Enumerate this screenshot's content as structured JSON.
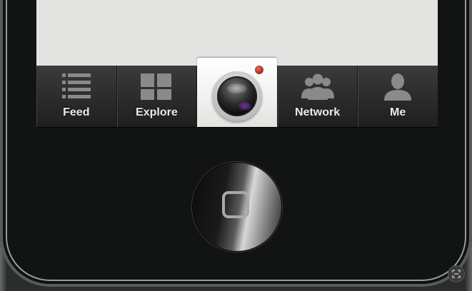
{
  "tabbar": {
    "items": [
      {
        "label": "Feed",
        "icon": "list-icon"
      },
      {
        "label": "Explore",
        "icon": "grid-icon"
      },
      {
        "label": "",
        "icon": "camera-lens-icon"
      },
      {
        "label": "Network",
        "icon": "people-icon"
      },
      {
        "label": "Me",
        "icon": "person-icon"
      }
    ]
  },
  "colors": {
    "screen_background": "#e3e3e2",
    "tabbar": "#2e2f2f",
    "icon_gray": "#8c8c8c",
    "record_dot": "#d02010"
  }
}
